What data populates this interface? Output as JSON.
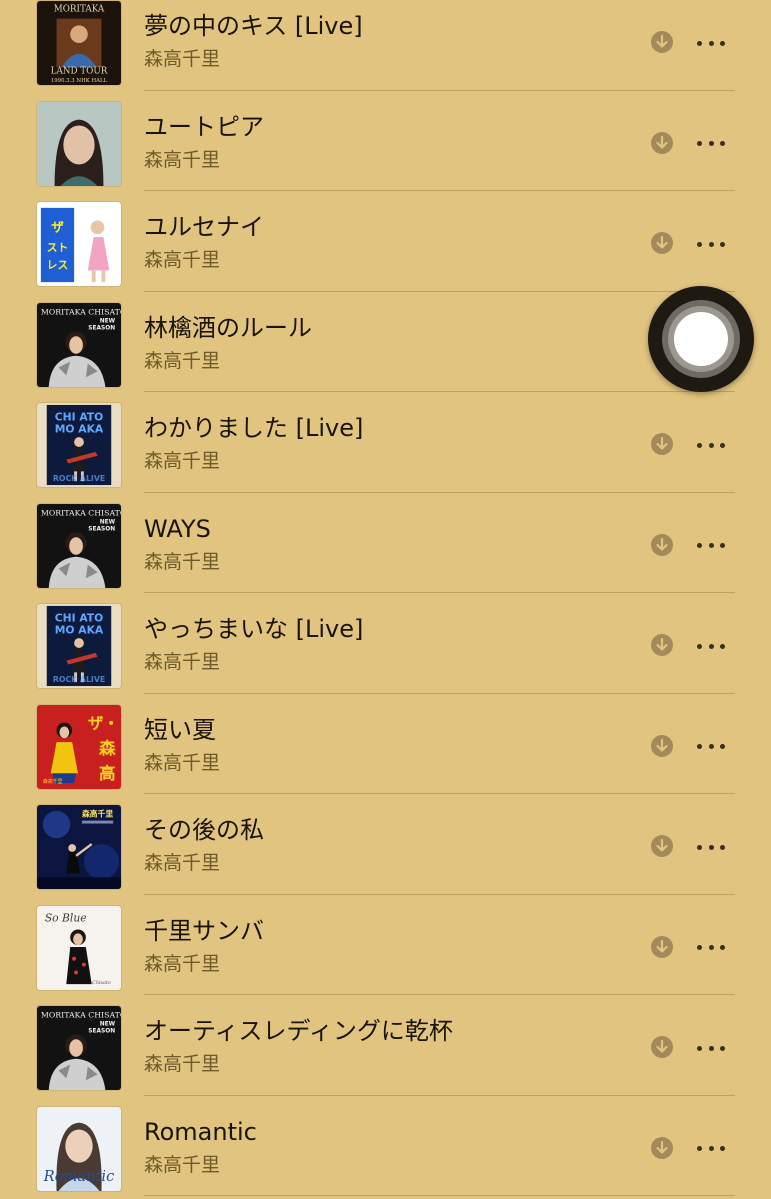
{
  "colors": {
    "background": "#e0c47f",
    "title": "#1a1408",
    "artist": "#6f5a2a",
    "download_badge": "#a4895a"
  },
  "tracks": [
    {
      "title": "夢の中のキス [Live]",
      "artist": "森高千里",
      "art": "land-tour",
      "art_text": [
        "MORITAKA",
        "LAND TOUR",
        "1990.3.3 NHK HALL"
      ]
    },
    {
      "title": "ユートピア",
      "artist": "森高千里",
      "art": "utopia"
    },
    {
      "title": "ユルセナイ",
      "artist": "森高千里",
      "art": "stress",
      "art_text": [
        "ザ・ストレス"
      ]
    },
    {
      "title": "林檎酒のルール",
      "artist": "森高千里",
      "art": "new-season",
      "art_text": [
        "MORITAKA CHISATO",
        "NEW",
        "SEASON"
      ]
    },
    {
      "title": "わかりました [Live]",
      "artist": "森高千里",
      "art": "live-rock",
      "art_text": [
        "CHI ATO",
        "MO AKA"
      ]
    },
    {
      "title": "WAYS",
      "artist": "森高千里",
      "art": "new-season",
      "art_text": [
        "MORITAKA CHISATO",
        "NEW",
        "SEASON"
      ]
    },
    {
      "title": "やっちまいな [Live]",
      "artist": "森高千里",
      "art": "live-rock",
      "art_text": [
        "CHI ATO",
        "MO AKA"
      ]
    },
    {
      "title": "短い夏",
      "artist": "森高千里",
      "art": "za-moritaka",
      "art_text": [
        "ザ・森高"
      ]
    },
    {
      "title": "その後の私",
      "artist": "森高千里",
      "art": "concert",
      "art_text": [
        "森高千里"
      ]
    },
    {
      "title": "千里サンバ",
      "artist": "森高千里",
      "art": "so-blue",
      "art_text": [
        "So Blue"
      ]
    },
    {
      "title": "オーティスレディングに乾杯",
      "artist": "森高千里",
      "art": "new-season",
      "art_text": [
        "MORITAKA CHISATO",
        "NEW",
        "SEASON"
      ]
    },
    {
      "title": "Romantic",
      "artist": "森高千里",
      "art": "romantic",
      "art_text": [
        "Romantic"
      ]
    }
  ],
  "icons": {
    "download": "arrow-down-circle-icon",
    "more": "ellipsis-icon",
    "assistive_touch": "assistive-touch-button"
  }
}
